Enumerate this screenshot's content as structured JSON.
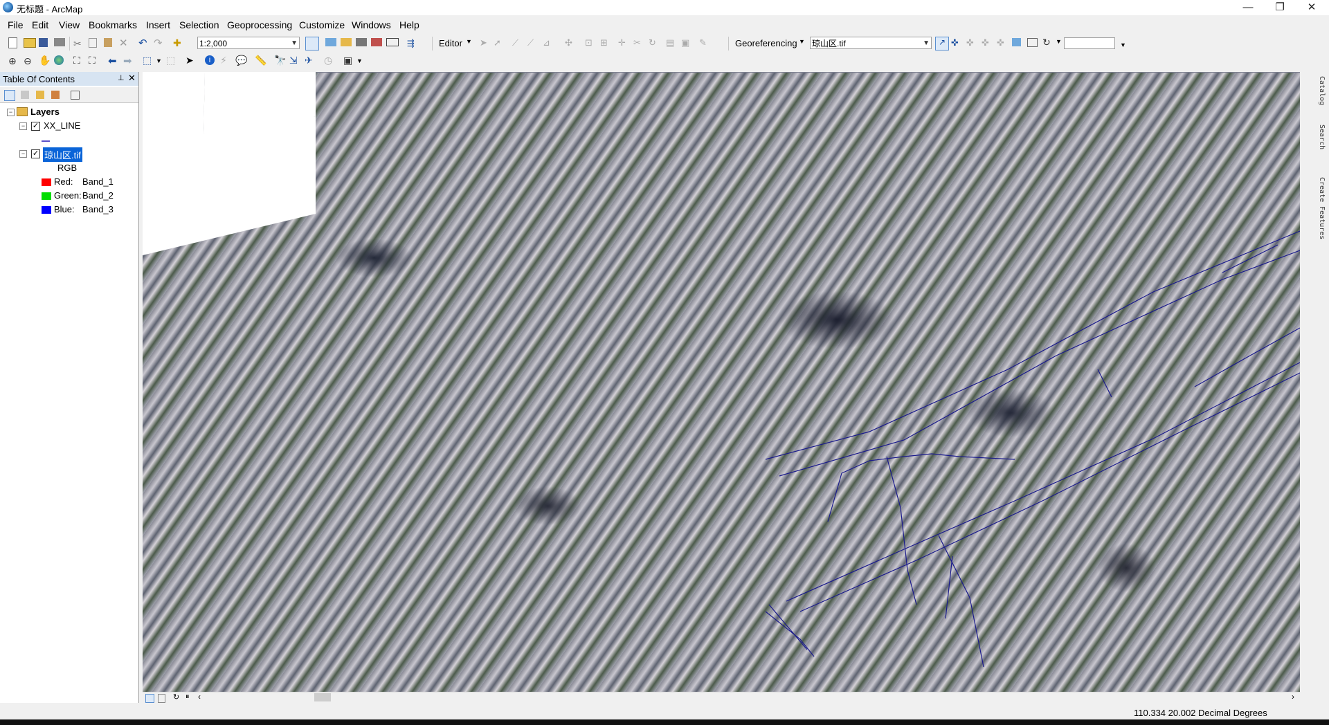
{
  "window": {
    "title": "无标题 - ArcMap",
    "minimize_glyph": "—",
    "restore_glyph": "❐",
    "close_glyph": "✕"
  },
  "menu": [
    "File",
    "Edit",
    "View",
    "Bookmarks",
    "Insert",
    "Selection",
    "Geoprocessing",
    "Customize",
    "Windows",
    "Help"
  ],
  "toolbar": {
    "scale": "1:2,000",
    "editor_label": "Editor",
    "georef_label": "Georeferencing",
    "georef_layer": "琼山区.tif",
    "georef_value": ""
  },
  "toc": {
    "title": "Table Of Contents",
    "pin_glyph": "📌",
    "close_glyph": "✕",
    "root": "Layers",
    "layers": [
      {
        "name": "XX_LINE",
        "checked": true
      },
      {
        "name": "琼山区.tif",
        "checked": true,
        "selected": true
      }
    ],
    "rgb_label": "RGB",
    "bands": [
      {
        "channel": "Red:",
        "band": "Band_1",
        "color": "#ff0000"
      },
      {
        "channel": "Green:",
        "band": "Band_2",
        "color": "#00dd00"
      },
      {
        "channel": "Blue:",
        "band": "Band_3",
        "color": "#0000ff"
      }
    ]
  },
  "side_tabs": [
    "Catalog",
    "Search",
    "Create Features"
  ],
  "status": {
    "coords": "110.334  20.002 Decimal Degrees"
  },
  "colors": {
    "line_color": "#1a1a8c",
    "selection_bg": "#0a64d8"
  }
}
